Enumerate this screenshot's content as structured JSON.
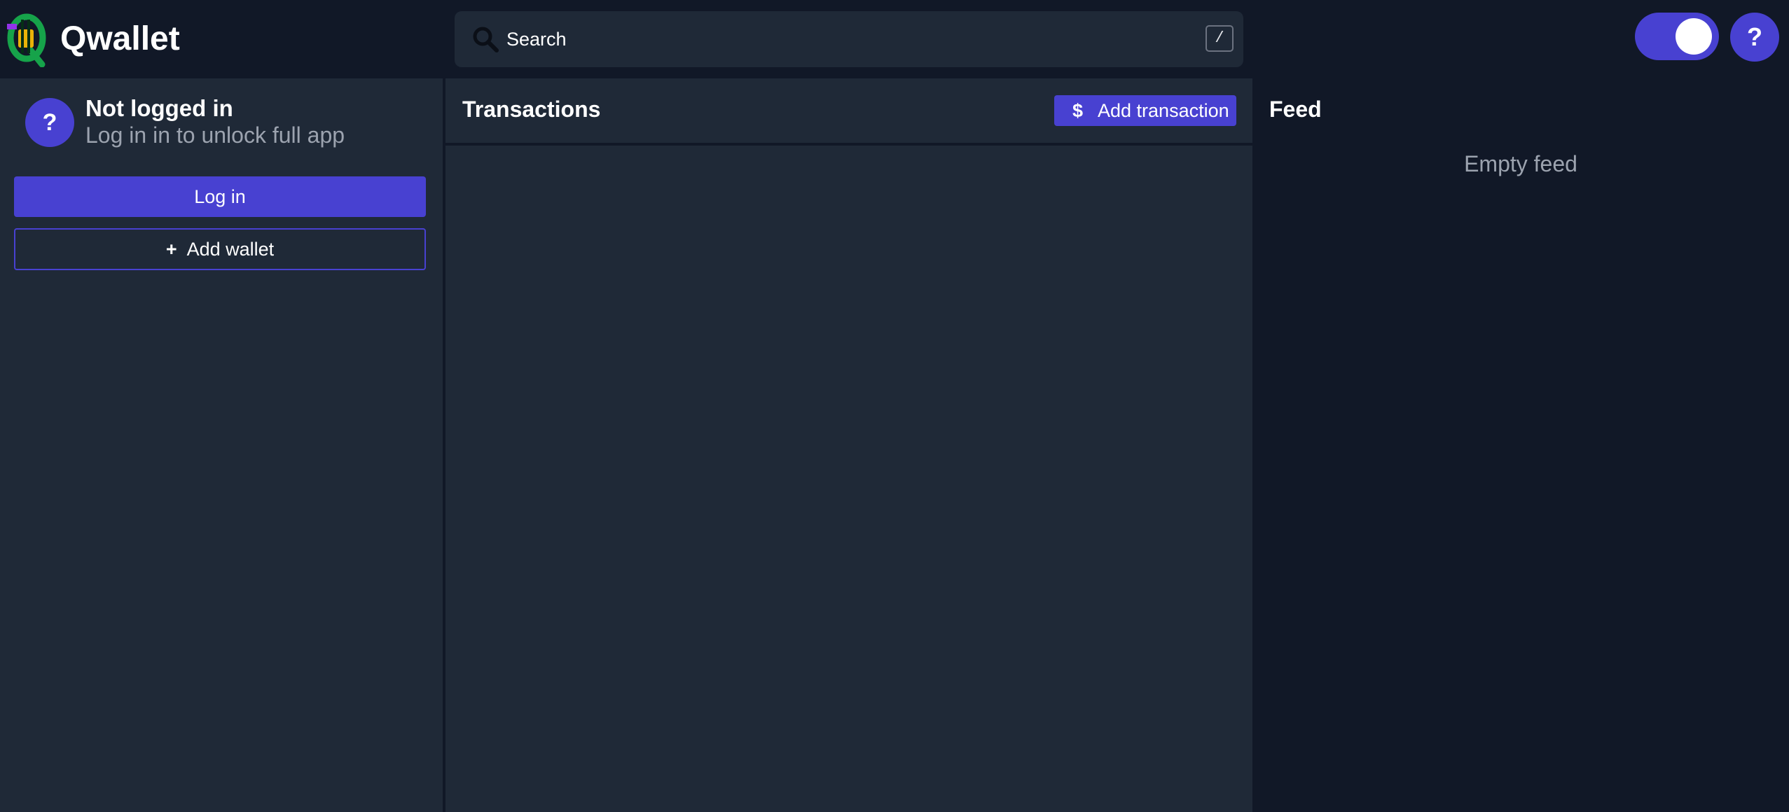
{
  "header": {
    "app_title": "Qwallet",
    "logo_icon": "qwallet-logo",
    "search": {
      "placeholder": "Search",
      "value": "",
      "shortcut": "/"
    },
    "theme_toggle": {
      "state": "on"
    },
    "help_label": "?"
  },
  "sidebar": {
    "avatar_label": "?",
    "user_title": "Not logged in",
    "user_subtitle": "Log in in to unlock full app",
    "login_label": "Log in",
    "add_wallet_icon": "+",
    "add_wallet_label": "Add wallet"
  },
  "transactions": {
    "title": "Transactions",
    "add_icon": "$",
    "add_label": "Add transaction",
    "items": []
  },
  "feed": {
    "title": "Feed",
    "empty_text": "Empty feed"
  },
  "colors": {
    "accent": "#4841d1",
    "background": "#111827",
    "panel": "#1f2937",
    "muted_text": "#9ca3af"
  }
}
